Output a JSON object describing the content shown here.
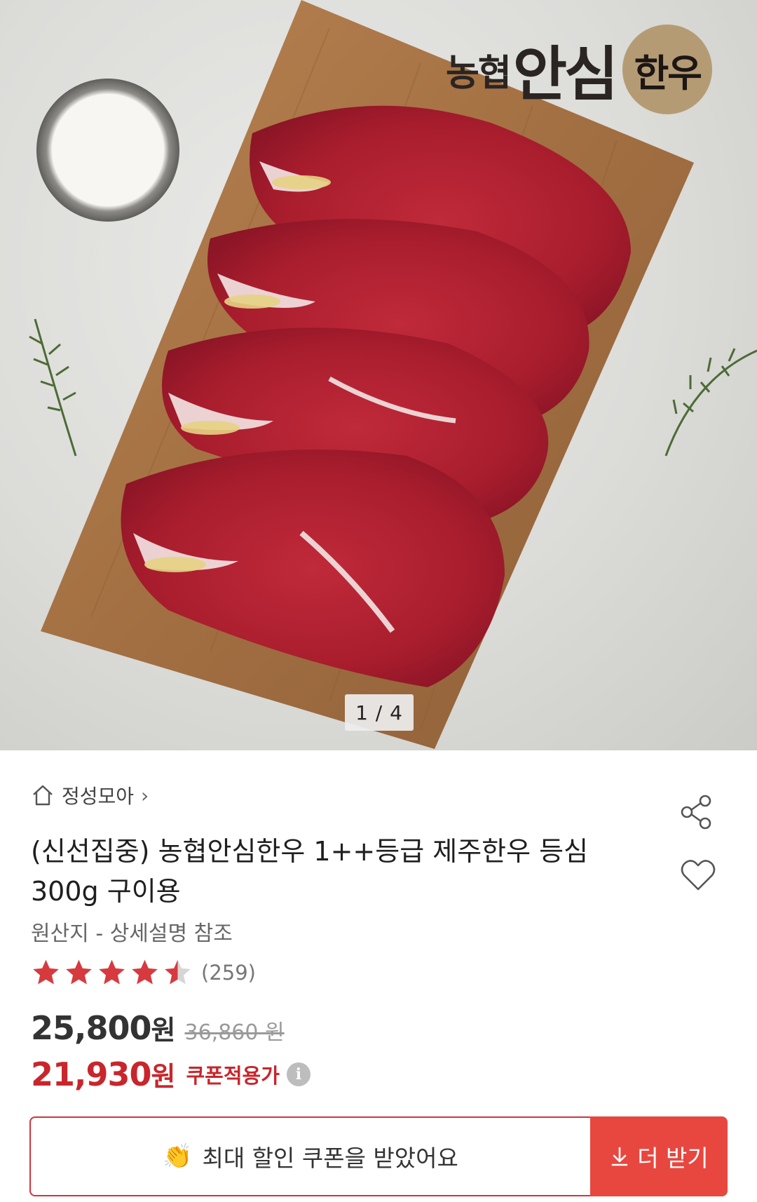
{
  "hero": {
    "counter": "1 / 4",
    "logo": {
      "text_main": "농협",
      "text_big": "안심",
      "badge": "한우"
    }
  },
  "store": {
    "name": "정성모아",
    "chevron": "›"
  },
  "product": {
    "title": "(신선집중) 농협안심한우 1++등급 제주한우 등심 300g 구이용",
    "origin": "원산지 - 상세설명 참조",
    "rating": {
      "score": 4.5,
      "max": 5,
      "count": "(259)"
    },
    "price": {
      "current": "25,800",
      "unit": "원",
      "original": "36,860 원"
    },
    "coupon_price": {
      "value": "21,930",
      "unit": "원",
      "label": "쿠폰적용가",
      "info_icon": "i"
    }
  },
  "coupon": {
    "message": "최대 할인 쿠폰을 받았어요",
    "emoji": "👏",
    "more_label": "더 받기"
  },
  "icons": {
    "home": "home-icon",
    "share": "share-icon",
    "like": "heart-icon",
    "info": "info-icon",
    "download": "download-icon"
  },
  "colors": {
    "accent_red": "#c8262c",
    "button_red": "#e8473f",
    "star_red": "#d63a3f"
  }
}
